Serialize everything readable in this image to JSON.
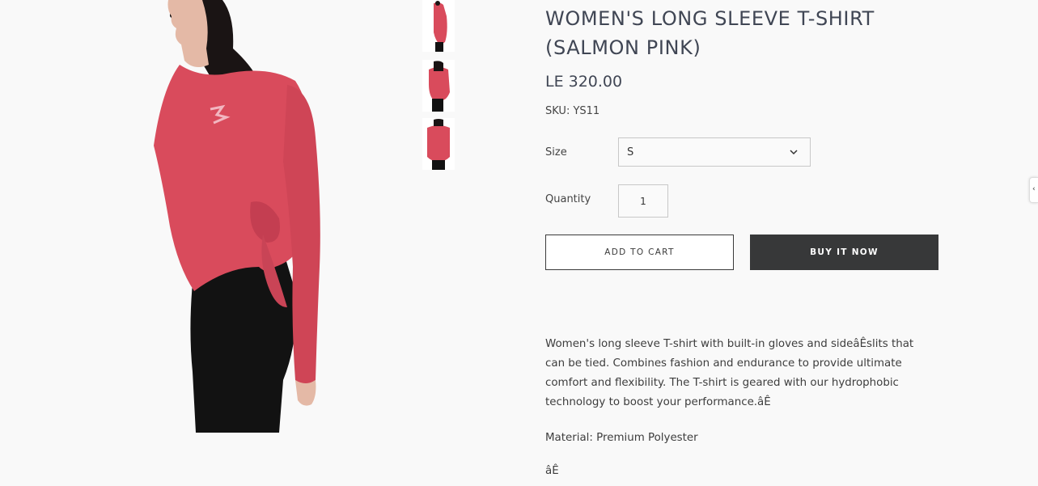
{
  "product": {
    "title": "WOMEN'S LONG SLEEVE T-SHIRT (SALMON PINK)",
    "price": "LE 320.00",
    "sku": "SKU: YS11",
    "size_label": "Size",
    "size_value": "S",
    "quantity_label": "Quantity",
    "quantity_value": "1",
    "add_to_cart": "ADD TO CART",
    "buy_it_now": "BUY IT NOW",
    "description": "Women's long sleeve T-shirt with built-in gloves and sideâÊslits that can be tied. Combines fashion and endurance to provide ultimate comfort and flexibility. The T-shirt is geared with our hydrophobic technology to boost your performance.âÊ",
    "material": "Material: Premium Polyester",
    "stray_chars": "âÊ"
  },
  "images": {
    "main": "model-side-view",
    "thumbnails": [
      "thumb-side-view",
      "thumb-back-view",
      "thumb-front-view"
    ]
  },
  "colors": {
    "shirt": "#d94b5c",
    "pants": "#121212",
    "buy_button": "#373839",
    "title": "#404654"
  },
  "icons": {
    "select": "chevron-down-icon",
    "side_tab": "chevron-left-icon"
  }
}
